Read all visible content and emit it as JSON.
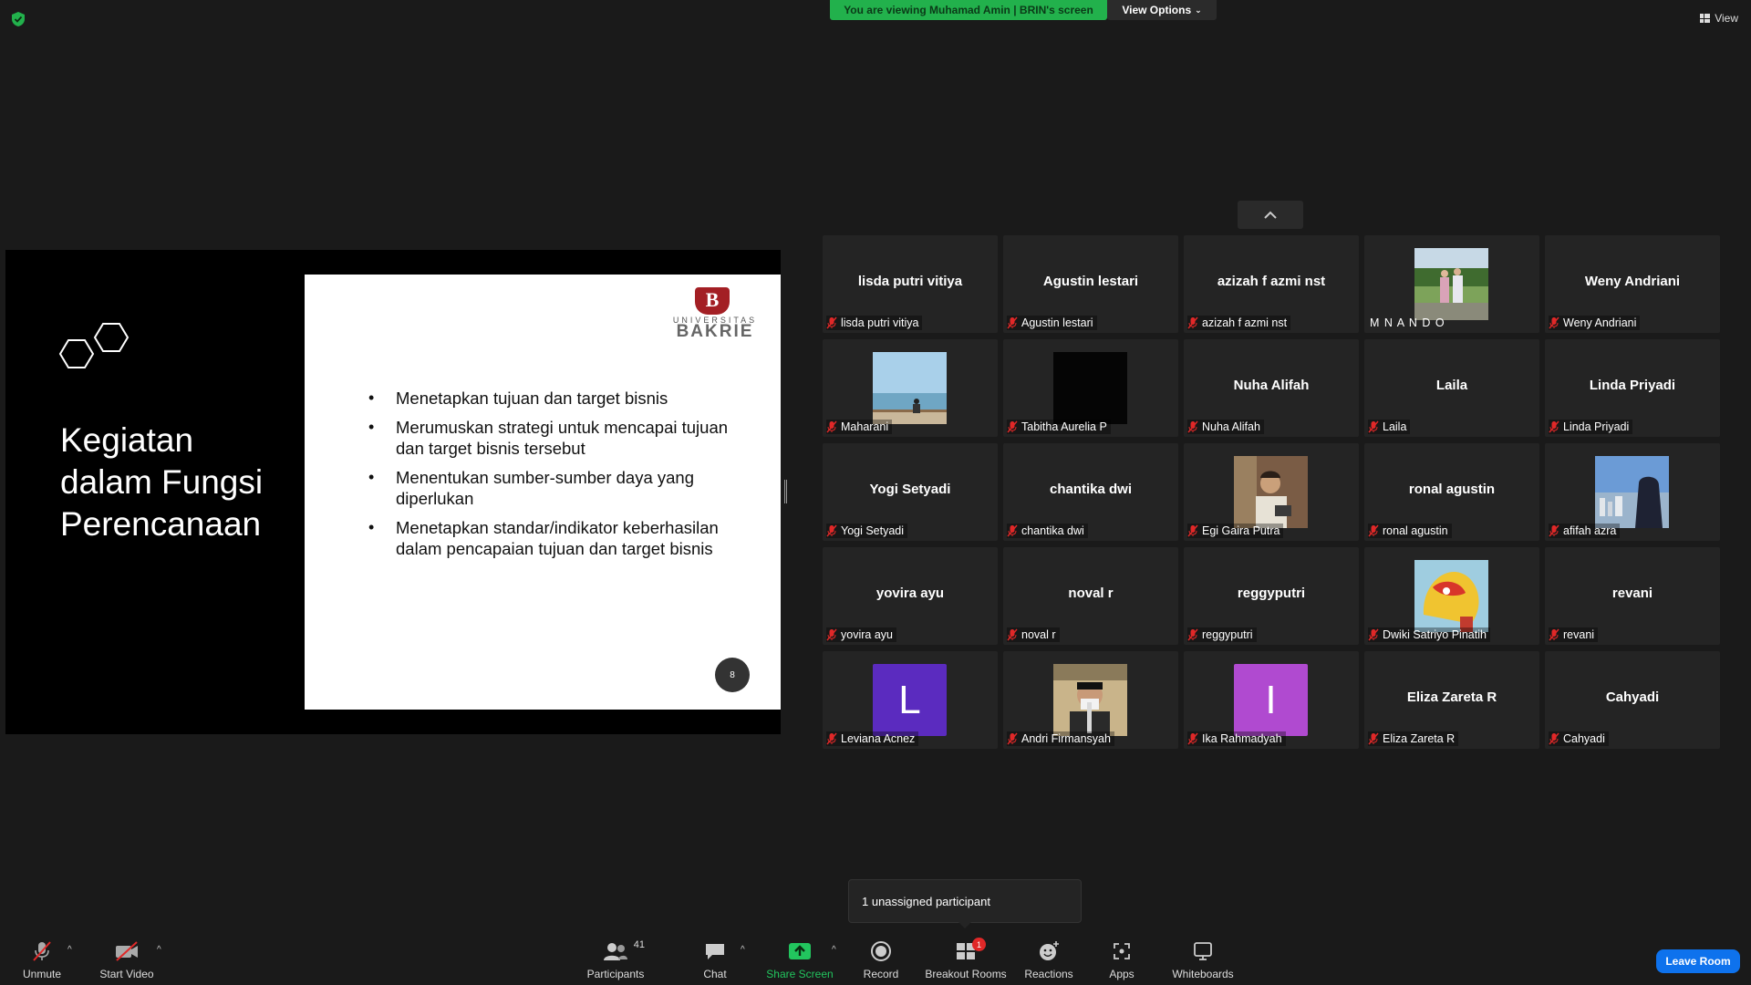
{
  "top": {
    "banner": "You are viewing Muhamad Amin | BRIN's screen",
    "view_options": "View Options",
    "view": "View"
  },
  "slide": {
    "title": "Kegiatan dalam Fungsi Perencanaan",
    "logo_univ": "UNIVERSITAS",
    "logo_name": "BAKRIE",
    "logo_letter": "B",
    "bullets": [
      "Menetapkan tujuan dan target bisnis",
      "Merumuskan strategi untuk mencapai tujuan dan target bisnis tersebut",
      "Menentukan sumber-sumber daya yang diperlukan",
      "Menetapkan standar/indikator keberhasilan dalam pencapaian tujuan dan target bisnis"
    ],
    "page_number": "8"
  },
  "participants": [
    {
      "name": "lisda putri vitiya",
      "big": "lisda putri vitiya"
    },
    {
      "name": "Agustin lestari",
      "big": "Agustin lestari"
    },
    {
      "name": "azizah f azmi nst",
      "big": "azizah f azmi nst"
    },
    {
      "name": "M N A N D O",
      "photo": "couple"
    },
    {
      "name": "Weny Andriani",
      "big": "Weny Andriani"
    },
    {
      "name": "Maharani",
      "photo": "sea"
    },
    {
      "name": "Tabitha Aurelia P",
      "photo": "black"
    },
    {
      "name": "Nuha Alifah",
      "big": "Nuha Alifah"
    },
    {
      "name": "Laila",
      "big": "Laila"
    },
    {
      "name": "Linda Priyadi",
      "big": "Linda Priyadi"
    },
    {
      "name": "Yogi Setyadi",
      "big": "Yogi Setyadi"
    },
    {
      "name": "chantika dwi",
      "big": "chantika dwi"
    },
    {
      "name": "Egi Gaira Putra",
      "photo": "person"
    },
    {
      "name": "ronal agustin",
      "big": "ronal agustin"
    },
    {
      "name": "afifah azra",
      "photo": "city"
    },
    {
      "name": "yovira ayu",
      "big": "yovira ayu"
    },
    {
      "name": "noval r",
      "big": "noval r"
    },
    {
      "name": "reggyputri",
      "big": "reggyputri"
    },
    {
      "name": "Dwiki Satriyo Pinatih",
      "photo": "lion"
    },
    {
      "name": "revani",
      "big": "revani"
    },
    {
      "name": "Leviana Acnez",
      "letter": "L",
      "color": "#5b2bbf"
    },
    {
      "name": "Andri Firmansyah",
      "photo": "masked"
    },
    {
      "name": "Ika Rahmadyah",
      "letter": "I",
      "color": "#b04ad0"
    },
    {
      "name": "Eliza Zareta R",
      "big": "Eliza Zareta R"
    },
    {
      "name": "Cahyadi",
      "big": "Cahyadi"
    }
  ],
  "toast": "1 unassigned participant",
  "toolbar": {
    "unmute": "Unmute",
    "start_video": "Start Video",
    "participants": "Participants",
    "participants_count": "41",
    "chat": "Chat",
    "share_screen": "Share Screen",
    "record": "Record",
    "breakout_rooms": "Breakout Rooms",
    "breakout_badge": "1",
    "reactions": "Reactions",
    "apps": "Apps",
    "whiteboards": "Whiteboards",
    "leave": "Leave Room"
  },
  "colors": {
    "banner_green": "#22b14c",
    "leave_blue": "#0e72ed",
    "mic_muted_red": "#e02828",
    "share_green": "#22c55e"
  }
}
